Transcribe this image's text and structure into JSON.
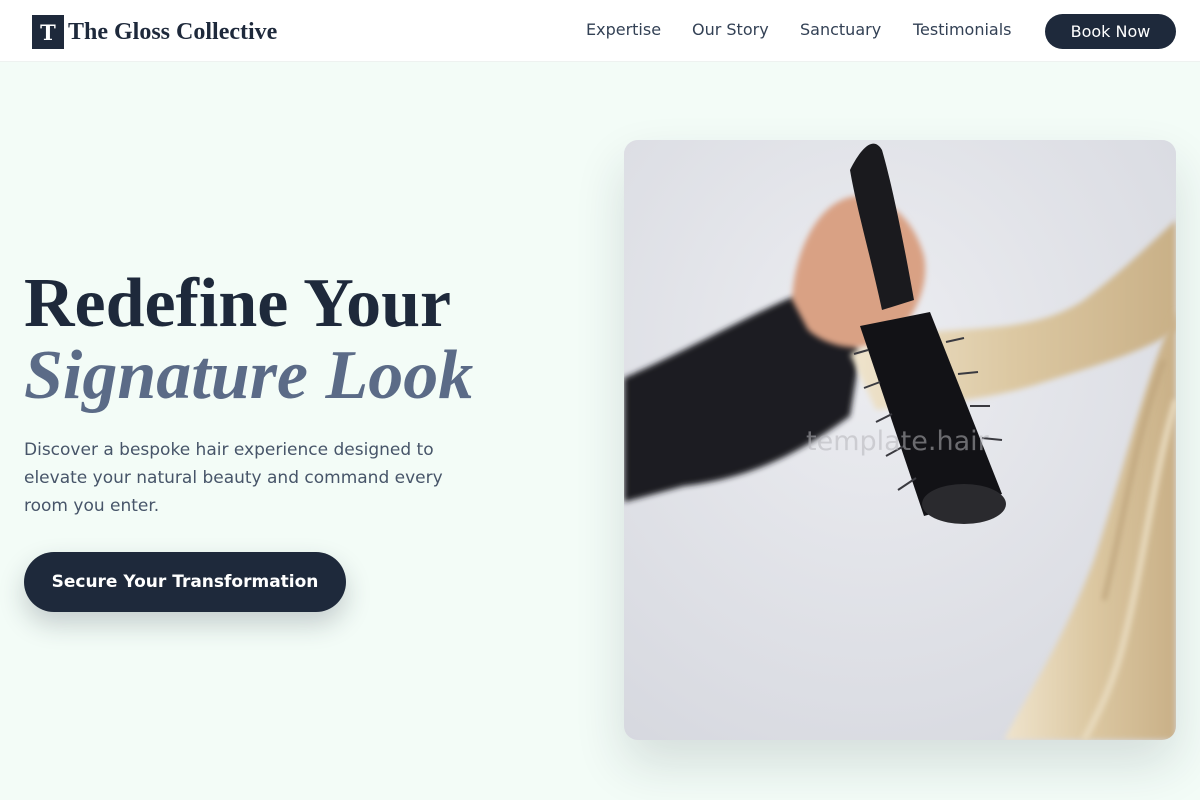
{
  "brand": {
    "mark": "T",
    "name": "The Gloss Collective"
  },
  "nav": {
    "items": [
      {
        "label": "Expertise"
      },
      {
        "label": "Our Story"
      },
      {
        "label": "Sanctuary"
      },
      {
        "label": "Testimonials"
      }
    ],
    "book_label": "Book Now"
  },
  "hero": {
    "headline_line1": "Redefine Your",
    "headline_line2": "Signature Look",
    "intro": "Discover a bespoke hair experience designed to elevate your natural beauty and command every room you enter.",
    "cta_label": "Secure Your Transformation",
    "image_watermark": "template.hair"
  },
  "colors": {
    "primary": "#1e293b",
    "accent_italic": "#5b6b87",
    "page_background": "#f3fcf7",
    "text_muted": "#475569"
  }
}
